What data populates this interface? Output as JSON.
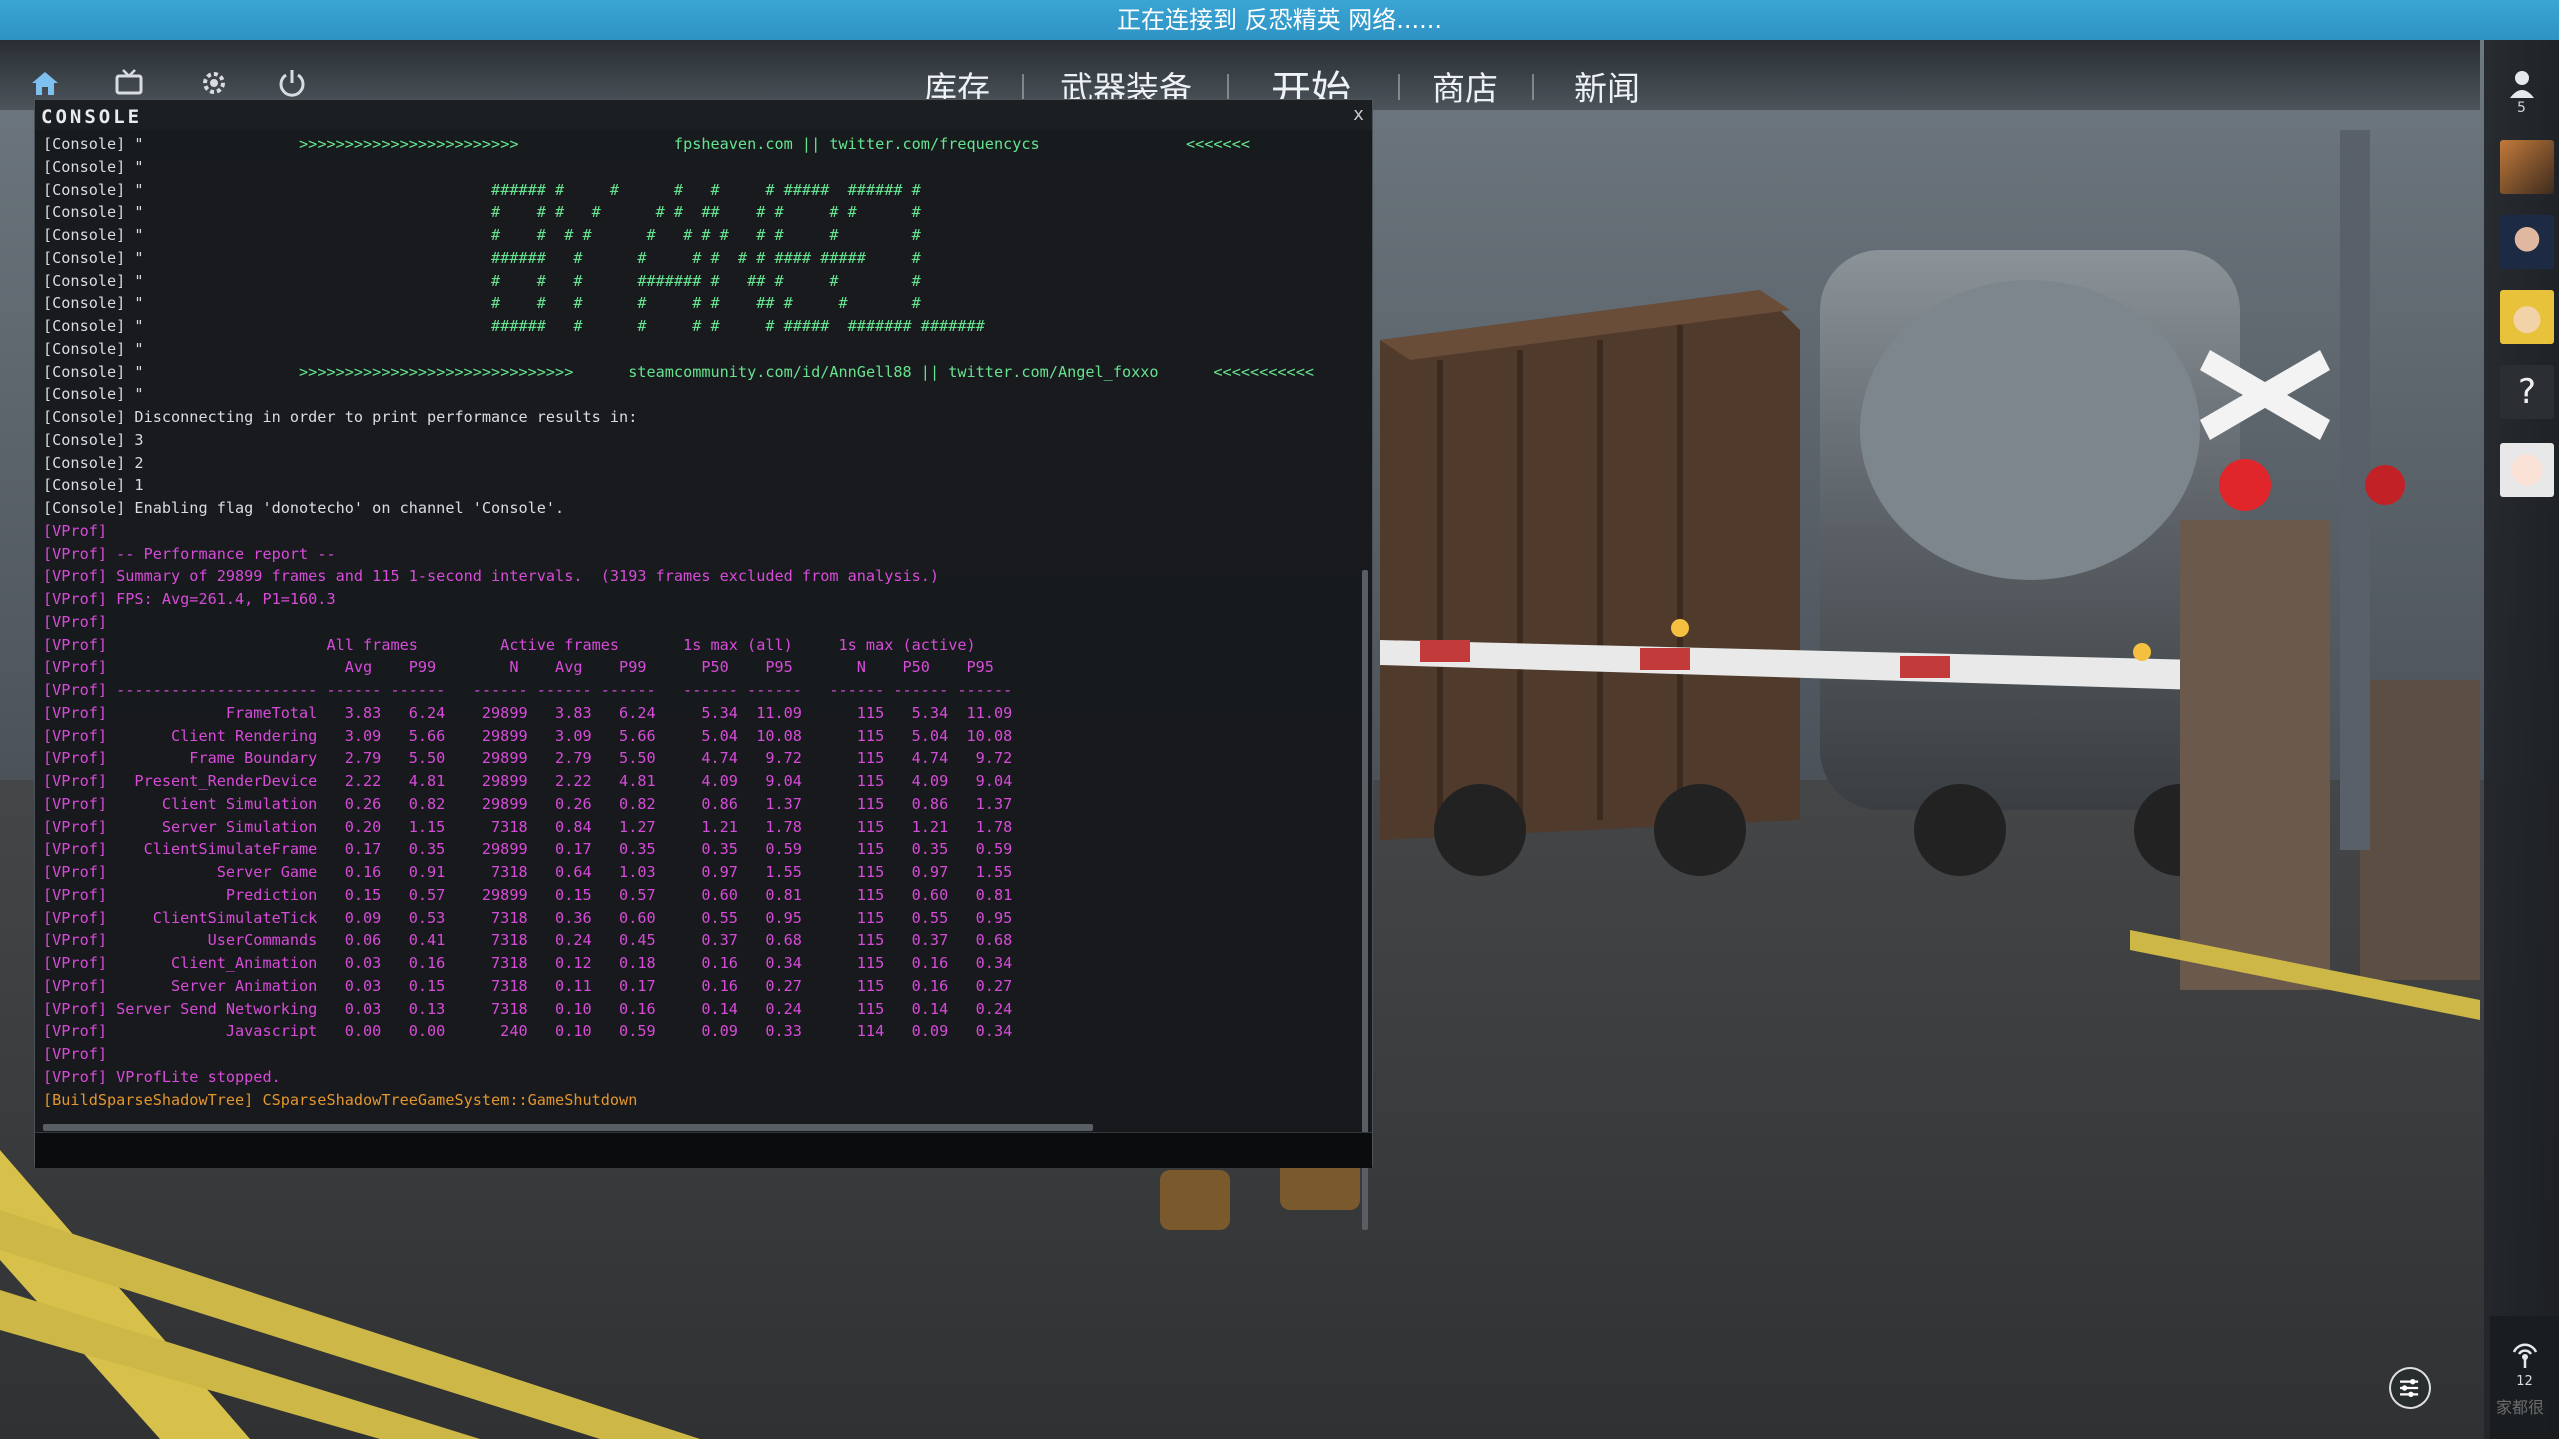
{
  "banner": {
    "text": "正在连接到 反恐精英 网络......"
  },
  "nav": {
    "icons": [
      "home-icon",
      "inventory-tv-icon",
      "settings-gear-icon",
      "power-icon"
    ],
    "tabs": [
      {
        "label": "库存"
      },
      {
        "label": "武器装备"
      },
      {
        "label": "开始"
      },
      {
        "label": "商店"
      },
      {
        "label": "新闻"
      }
    ]
  },
  "rightbar": {
    "friends_count": "5",
    "help_label": "?",
    "signal_count": "12",
    "watermark": "家都很"
  },
  "console": {
    "title": "CONSOLE",
    "close_label": "x",
    "input_value": "",
    "lines": [
      {
        "cls": "c-console",
        "text": "[Console] \"",
        "tail_cls": "c-green",
        "tail": "                 >>>>>>>>>>>>>>>>>>>>>>>>                 fpsheaven.com || twitter.com/frequencycs                <<<<<<<"
      },
      {
        "cls": "c-console",
        "text": "[Console] \"",
        "tail_cls": "c-green",
        "tail": ""
      },
      {
        "cls": "c-console",
        "text": "[Console] \"",
        "tail_cls": "c-green",
        "tail": "                                      ###### #     #      #   #     # #####  ###### #"
      },
      {
        "cls": "c-console",
        "text": "[Console] \"",
        "tail_cls": "c-green",
        "tail": "                                      #    # #   #      # #  ##    # #     # #      #"
      },
      {
        "cls": "c-console",
        "text": "[Console] \"",
        "tail_cls": "c-green",
        "tail": "                                      #    #  # #      #   # # #   # #     #        #"
      },
      {
        "cls": "c-console",
        "text": "[Console] \"",
        "tail_cls": "c-green",
        "tail": "                                      ######   #      #     # #  # # #### #####     #"
      },
      {
        "cls": "c-console",
        "text": "[Console] \"",
        "tail_cls": "c-green",
        "tail": "                                      #    #   #      ####### #   ## #     #        #"
      },
      {
        "cls": "c-console",
        "text": "[Console] \"",
        "tail_cls": "c-green",
        "tail": "                                      #    #   #      #     # #    ## #     #       #"
      },
      {
        "cls": "c-console",
        "text": "[Console] \"",
        "tail_cls": "c-green",
        "tail": "                                      ######   #      #     # #     # #####  ####### #######"
      },
      {
        "cls": "c-console",
        "text": "[Console] \"",
        "tail_cls": "c-green",
        "tail": ""
      },
      {
        "cls": "c-console",
        "text": "[Console] \"",
        "tail_cls": "c-green",
        "tail": "                 >>>>>>>>>>>>>>>>>>>>>>>>>>>>>>      steamcommunity.com/id/AnnGell88 || twitter.com/Angel_foxxo      <<<<<<<<<<<"
      },
      {
        "cls": "c-console",
        "text": "[Console] \"",
        "tail_cls": "c-green",
        "tail": ""
      },
      {
        "cls": "c-console",
        "text": "[Console] Disconnecting in order to print performance results in:",
        "tail_cls": "",
        "tail": ""
      },
      {
        "cls": "c-console",
        "text": "[Console] 3",
        "tail_cls": "",
        "tail": ""
      },
      {
        "cls": "c-console",
        "text": "[Console] 2",
        "tail_cls": "",
        "tail": ""
      },
      {
        "cls": "c-console",
        "text": "[Console] 1",
        "tail_cls": "",
        "tail": ""
      },
      {
        "cls": "c-console",
        "text": "[Console] Enabling flag 'donotecho' on channel 'Console'.",
        "tail_cls": "",
        "tail": ""
      },
      {
        "cls": "c-vprof",
        "text": "[VProf]",
        "tail_cls": "",
        "tail": ""
      },
      {
        "cls": "c-vprof",
        "text": "[VProf] -- Performance report --",
        "tail_cls": "",
        "tail": ""
      },
      {
        "cls": "c-vprof",
        "text": "[VProf] Summary of 29899 frames and 115 1-second intervals.  (3193 frames excluded from analysis.)",
        "tail_cls": "",
        "tail": ""
      },
      {
        "cls": "c-vprof",
        "text": "[VProf] FPS: Avg=261.4, P1=160.3",
        "tail_cls": "",
        "tail": ""
      },
      {
        "cls": "c-vprof",
        "text": "[VProf]",
        "tail_cls": "",
        "tail": ""
      },
      {
        "cls": "c-vprof",
        "text": "[VProf]                        All frames         Active frames       1s max (all)     1s max (active)",
        "tail_cls": "",
        "tail": ""
      },
      {
        "cls": "c-vprof",
        "text": "[VProf]                          Avg    P99        N    Avg    P99      P50    P95       N    P50    P95",
        "tail_cls": "",
        "tail": ""
      },
      {
        "cls": "c-vprof",
        "text": "[VProf] ---------------------- ------ ------   ------ ------ ------   ------ ------   ------ ------ ------",
        "tail_cls": "",
        "tail": ""
      },
      {
        "cls": "c-vprof",
        "text": "[VProf]             FrameTotal   3.83   6.24    29899   3.83   6.24     5.34  11.09      115   5.34  11.09",
        "tail_cls": "",
        "tail": ""
      },
      {
        "cls": "c-vprof",
        "text": "[VProf]       Client Rendering   3.09   5.66    29899   3.09   5.66     5.04  10.08      115   5.04  10.08",
        "tail_cls": "",
        "tail": ""
      },
      {
        "cls": "c-vprof",
        "text": "[VProf]         Frame Boundary   2.79   5.50    29899   2.79   5.50     4.74   9.72      115   4.74   9.72",
        "tail_cls": "",
        "tail": ""
      },
      {
        "cls": "c-vprof",
        "text": "[VProf]   Present_RenderDevice   2.22   4.81    29899   2.22   4.81     4.09   9.04      115   4.09   9.04",
        "tail_cls": "",
        "tail": ""
      },
      {
        "cls": "c-vprof",
        "text": "[VProf]      Client Simulation   0.26   0.82    29899   0.26   0.82     0.86   1.37      115   0.86   1.37",
        "tail_cls": "",
        "tail": ""
      },
      {
        "cls": "c-vprof",
        "text": "[VProf]      Server Simulation   0.20   1.15     7318   0.84   1.27     1.21   1.78      115   1.21   1.78",
        "tail_cls": "",
        "tail": ""
      },
      {
        "cls": "c-vprof",
        "text": "[VProf]    ClientSimulateFrame   0.17   0.35    29899   0.17   0.35     0.35   0.59      115   0.35   0.59",
        "tail_cls": "",
        "tail": ""
      },
      {
        "cls": "c-vprof",
        "text": "[VProf]            Server Game   0.16   0.91     7318   0.64   1.03     0.97   1.55      115   0.97   1.55",
        "tail_cls": "",
        "tail": ""
      },
      {
        "cls": "c-vprof",
        "text": "[VProf]             Prediction   0.15   0.57    29899   0.15   0.57     0.60   0.81      115   0.60   0.81",
        "tail_cls": "",
        "tail": ""
      },
      {
        "cls": "c-vprof",
        "text": "[VProf]     ClientSimulateTick   0.09   0.53     7318   0.36   0.60     0.55   0.95      115   0.55   0.95",
        "tail_cls": "",
        "tail": ""
      },
      {
        "cls": "c-vprof",
        "text": "[VProf]           UserCommands   0.06   0.41     7318   0.24   0.45     0.37   0.68      115   0.37   0.68",
        "tail_cls": "",
        "tail": ""
      },
      {
        "cls": "c-vprof",
        "text": "[VProf]       Client_Animation   0.03   0.16     7318   0.12   0.18     0.16   0.34      115   0.16   0.34",
        "tail_cls": "",
        "tail": ""
      },
      {
        "cls": "c-vprof",
        "text": "[VProf]       Server Animation   0.03   0.15     7318   0.11   0.17     0.16   0.27      115   0.16   0.27",
        "tail_cls": "",
        "tail": ""
      },
      {
        "cls": "c-vprof",
        "text": "[VProf] Server Send Networking   0.03   0.13     7318   0.10   0.16     0.14   0.24      115   0.14   0.24",
        "tail_cls": "",
        "tail": ""
      },
      {
        "cls": "c-vprof",
        "text": "[VProf]             Javascript   0.00   0.00      240   0.10   0.59     0.09   0.33      114   0.09   0.34",
        "tail_cls": "",
        "tail": ""
      },
      {
        "cls": "c-vprof",
        "text": "[VProf]",
        "tail_cls": "",
        "tail": ""
      },
      {
        "cls": "c-vprof",
        "text": "[VProf] VProfLite stopped.",
        "tail_cls": "",
        "tail": ""
      },
      {
        "cls": "c-orange",
        "text": "[BuildSparseShadowTree] CSparseShadowTreeGameSystem::GameShutdown",
        "tail_cls": "",
        "tail": ""
      }
    ]
  },
  "colors": {
    "banner": "#2e93c4",
    "console_text": "#d8dde1",
    "console_green": "#66e38f",
    "vprof_magenta": "#d74bd9",
    "warning_orange": "#e3962e"
  }
}
